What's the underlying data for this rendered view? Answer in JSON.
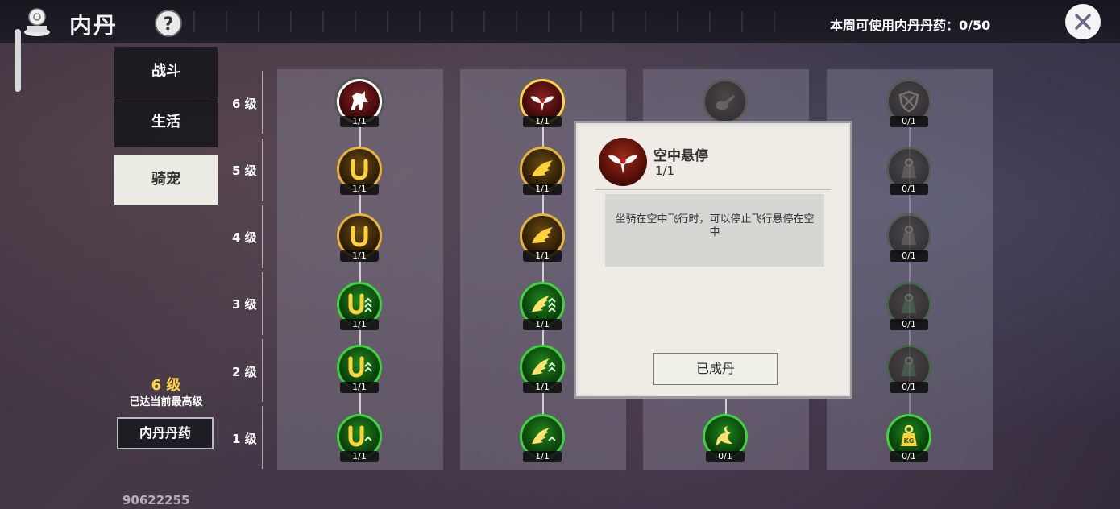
{
  "header": {
    "title": "内丹",
    "help_label": "?",
    "weekly_usage": "本周可使用内丹丹药：0/50"
  },
  "sidebar": {
    "tabs": [
      {
        "label": "战斗"
      },
      {
        "label": "生活"
      },
      {
        "label": "骑宠",
        "active": true
      }
    ],
    "level_value": "6 级",
    "level_status": "已达当前最高级",
    "medicine_button": "内丹丹药",
    "player_id": "90622255"
  },
  "levels": [
    "6 级",
    "5 级",
    "4 级",
    "3 级",
    "2 级",
    "1 级"
  ],
  "columns": [
    {
      "icon_theme": "horseshoe",
      "nodes": [
        {
          "level": "6 级",
          "icon": "horse-icon",
          "count": "1/1"
        },
        {
          "level": "5 级",
          "icon": "horseshoe-icon",
          "count": "1/1"
        },
        {
          "level": "4 级",
          "icon": "horseshoe-icon",
          "count": "1/1"
        },
        {
          "level": "3 级",
          "icon": "horseshoe-up-icon",
          "count": "1/1"
        },
        {
          "level": "2 级",
          "icon": "horseshoe-up-icon",
          "count": "1/1"
        },
        {
          "level": "1 级",
          "icon": "horseshoe-up-icon",
          "count": "1/1"
        }
      ]
    },
    {
      "icon_theme": "wing",
      "nodes": [
        {
          "level": "6 级",
          "icon": "winged-emblem-icon",
          "count": "1/1"
        },
        {
          "level": "5 级",
          "icon": "wing-icon",
          "count": "1/1"
        },
        {
          "level": "4 级",
          "icon": "wing-icon",
          "count": "1/1"
        },
        {
          "level": "3 级",
          "icon": "wing-up-icon",
          "count": "1/1"
        },
        {
          "level": "2 级",
          "icon": "wing-up-icon",
          "count": "1/1"
        },
        {
          "level": "1 级",
          "icon": "wing-up-icon",
          "count": "1/1"
        }
      ]
    },
    {
      "icon_theme": "tail",
      "nodes": [
        {
          "level": "6 级",
          "icon": "pipe-icon",
          "count": ""
        },
        {
          "level": "1 级",
          "icon": "tail-icon",
          "count": "0/1"
        }
      ]
    },
    {
      "icon_theme": "weight",
      "nodes": [
        {
          "level": "6 级",
          "icon": "shield-icon",
          "count": "0/1"
        },
        {
          "level": "5 级",
          "icon": "weight-icon",
          "count": "0/1"
        },
        {
          "level": "4 级",
          "icon": "weight-icon",
          "count": "0/1"
        },
        {
          "level": "3 级",
          "icon": "weight-icon",
          "count": "0/1"
        },
        {
          "level": "2 级",
          "icon": "weight-icon",
          "count": "0/1"
        },
        {
          "level": "1 级",
          "icon": "weight-icon",
          "count": "0/1"
        }
      ]
    }
  ],
  "popup": {
    "name": "空中悬停",
    "count": "1/1",
    "description": "坐骑在空中飞行时，可以停止飞行悬停在空中",
    "button": "已成丹"
  },
  "colors": {
    "gold_ring": "#e6b536",
    "green_ring": "#3fd13f",
    "level_highlight": "#ffd33d",
    "active_tab_bg": "#ecece4",
    "popup_bg": "#eeece4"
  }
}
